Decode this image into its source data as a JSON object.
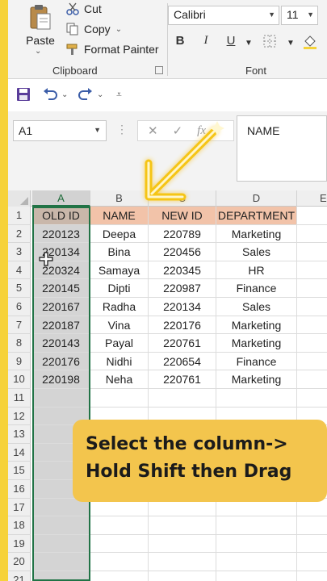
{
  "ribbon": {
    "paste_label": "Paste",
    "cut_label": "Cut",
    "copy_label": "Copy",
    "format_painter_label": "Format Painter",
    "clipboard_group_label": "Clipboard",
    "font_name": "Calibri",
    "font_size": "11",
    "font_group_label": "Font",
    "bold": "B",
    "italic": "I",
    "underline": "U"
  },
  "formula_bar": {
    "name_box": "A1",
    "cancel": "✕",
    "enter": "✓",
    "fx": "fx",
    "value": "NAME"
  },
  "columns": [
    "A",
    "B",
    "C",
    "D",
    "E"
  ],
  "row_numbers": [
    "1",
    "2",
    "3",
    "4",
    "5",
    "6",
    "7",
    "8",
    "9",
    "10",
    "11",
    "12",
    "13",
    "14",
    "15",
    "16",
    "17",
    "18",
    "19",
    "20",
    "21"
  ],
  "table": {
    "headers": [
      "OLD ID",
      "NAME",
      "NEW ID",
      "DEPARTMENT"
    ],
    "rows": [
      [
        "220123",
        "Deepa",
        "220789",
        "Marketing"
      ],
      [
        "220134",
        "Bina",
        "220456",
        "Sales"
      ],
      [
        "220324",
        "Samaya",
        "220345",
        "HR"
      ],
      [
        "220145",
        "Dipti",
        "220987",
        "Finance"
      ],
      [
        "220167",
        "Radha",
        "220134",
        "Sales"
      ],
      [
        "220187",
        "Vina",
        "220176",
        "Marketing"
      ],
      [
        "220143",
        "Payal",
        "220761",
        "Marketing"
      ],
      [
        "220176",
        "Nidhi",
        "220654",
        "Finance"
      ],
      [
        "220198",
        "Neha",
        "220761",
        "Marketing"
      ]
    ]
  },
  "callout": {
    "line1": "Select the column->",
    "line2": "Hold Shift then Drag"
  },
  "colors": {
    "header_fill": "#f2c3a9",
    "selection_green": "#217346",
    "callout_yellow": "#f3c54d",
    "arrow_yellow": "#f5c518"
  }
}
